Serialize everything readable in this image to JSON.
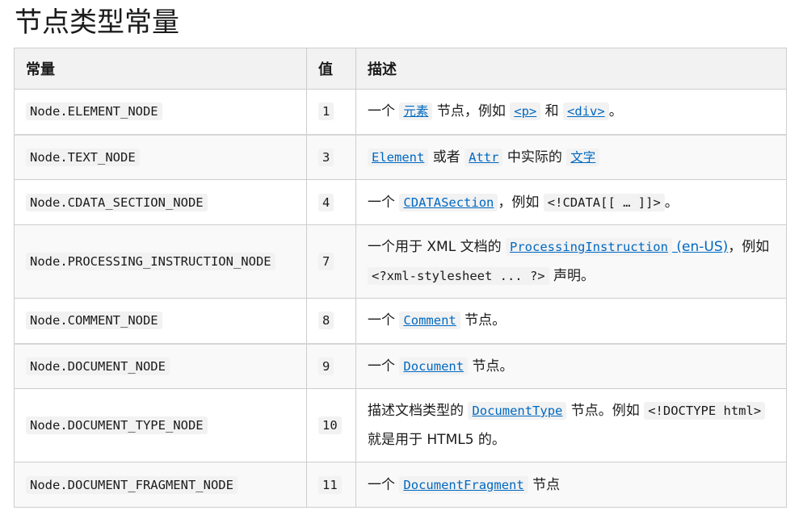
{
  "page": {
    "title": "节点类型常量"
  },
  "table": {
    "headers": [
      "常量",
      "值",
      "描述"
    ],
    "rows": [
      {
        "constant": "Node.ELEMENT_NODE",
        "value": "1",
        "description": [
          {
            "t": "text",
            "v": "一个 "
          },
          {
            "t": "link-code",
            "v": "元素",
            "name": "element-link"
          },
          {
            "t": "text",
            "v": " 节点，例如 "
          },
          {
            "t": "link-code",
            "v": "<p>",
            "name": "p-element-link"
          },
          {
            "t": "text",
            "v": " 和 "
          },
          {
            "t": "link-code",
            "v": "<div>",
            "name": "div-element-link"
          },
          {
            "t": "text",
            "v": "。"
          }
        ]
      },
      {
        "constant": "Node.TEXT_NODE",
        "value": "3",
        "description": [
          {
            "t": "link-code",
            "v": "Element",
            "name": "element-interface-link"
          },
          {
            "t": "text",
            "v": " 或者 "
          },
          {
            "t": "link-code",
            "v": "Attr",
            "name": "attr-link"
          },
          {
            "t": "text",
            "v": " 中实际的 "
          },
          {
            "t": "link-code",
            "v": "文字",
            "name": "text-link"
          }
        ]
      },
      {
        "constant": "Node.CDATA_SECTION_NODE",
        "value": "4",
        "description": [
          {
            "t": "text",
            "v": "一个 "
          },
          {
            "t": "link-code",
            "v": "CDATASection",
            "name": "cdatasection-link"
          },
          {
            "t": "text",
            "v": "，例如 "
          },
          {
            "t": "code",
            "v": "<!CDATA[[ … ]]>"
          },
          {
            "t": "text",
            "v": "。"
          }
        ]
      },
      {
        "constant": "Node.PROCESSING_INSTRUCTION_NODE",
        "value": "7",
        "tall": true,
        "description": [
          {
            "t": "text",
            "v": "一个用于 XML 文档的 "
          },
          {
            "t": "link-code",
            "v": "ProcessingInstruction",
            "name": "processinginstruction-link"
          },
          {
            "t": "link",
            "v": " (en-US)",
            "name": "en-us-link"
          },
          {
            "t": "text",
            "v": "，例如 "
          },
          {
            "t": "code",
            "v": "<?xml-stylesheet ... ?>"
          },
          {
            "t": "text",
            "v": " 声明。"
          }
        ]
      },
      {
        "constant": "Node.COMMENT_NODE",
        "value": "8",
        "description": [
          {
            "t": "text",
            "v": "一个 "
          },
          {
            "t": "link-code",
            "v": "Comment",
            "name": "comment-link"
          },
          {
            "t": "text",
            "v": " 节点。"
          }
        ]
      },
      {
        "constant": "Node.DOCUMENT_NODE",
        "value": "9",
        "description": [
          {
            "t": "text",
            "v": "一个 "
          },
          {
            "t": "link-code",
            "v": "Document",
            "name": "document-link"
          },
          {
            "t": "text",
            "v": " 节点。"
          }
        ]
      },
      {
        "constant": "Node.DOCUMENT_TYPE_NODE",
        "value": "10",
        "tall": true,
        "description": [
          {
            "t": "text",
            "v": "描述文档类型的 "
          },
          {
            "t": "link-code",
            "v": "DocumentType",
            "name": "documenttype-link"
          },
          {
            "t": "text",
            "v": " 节点。例如 "
          },
          {
            "t": "code",
            "v": "<!DOCTYPE html>"
          },
          {
            "t": "text",
            "v": " 就是用于 HTML5 的。"
          }
        ]
      },
      {
        "constant": "Node.DOCUMENT_FRAGMENT_NODE",
        "value": "11",
        "description": [
          {
            "t": "text",
            "v": "一个 "
          },
          {
            "t": "link-code",
            "v": "DocumentFragment",
            "name": "documentfragment-link"
          },
          {
            "t": "text",
            "v": " 节点"
          }
        ]
      }
    ]
  }
}
